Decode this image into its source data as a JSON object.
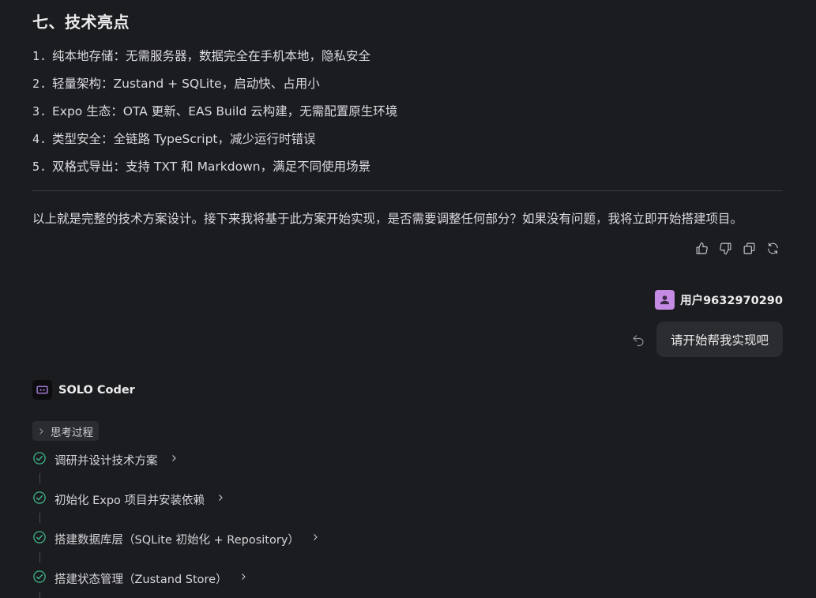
{
  "section": {
    "title": "七、技术亮点"
  },
  "highlights": [
    {
      "num": "1.",
      "text": "纯本地存储：无需服务器，数据完全在手机本地，隐私安全"
    },
    {
      "num": "2.",
      "text": "轻量架构：Zustand + SQLite，启动快、占用小"
    },
    {
      "num": "3.",
      "text": "Expo 生态：OTA 更新、EAS Build 云构建，无需配置原生环境"
    },
    {
      "num": "4.",
      "text": "类型安全：全链路 TypeScript，减少运行时错误"
    },
    {
      "num": "5.",
      "text": "双格式导出：支持 TXT 和 Markdown，满足不同使用场景"
    }
  ],
  "summary": "以上就是完整的技术方案设计。接下来我将基于此方案开始实现，是否需要调整任何部分？如果没有问题，我将立即开始搭建项目。",
  "actions": [
    {
      "icon": "thumbs-up-icon"
    },
    {
      "icon": "thumbs-down-icon"
    },
    {
      "icon": "copy-icon"
    },
    {
      "icon": "refresh-icon"
    }
  ],
  "user": {
    "name": "用户9632970290",
    "message": "请开始帮我实现吧",
    "avatar_color": "#c58be4"
  },
  "agent": {
    "name": "SOLO Coder",
    "thinking_label": "思考过程"
  },
  "steps": [
    {
      "label": "调研并设计技术方案",
      "status": "done"
    },
    {
      "label": "初始化 Expo 项目并安装依赖",
      "status": "done"
    },
    {
      "label": "搭建数据库层（SQLite 初始化 + Repository）",
      "status": "done"
    },
    {
      "label": "搭建状态管理（Zustand Store）",
      "status": "done"
    }
  ],
  "colors": {
    "background": "#1b1c1f",
    "check": "#3fb68b",
    "bubble": "#2b2c30"
  }
}
